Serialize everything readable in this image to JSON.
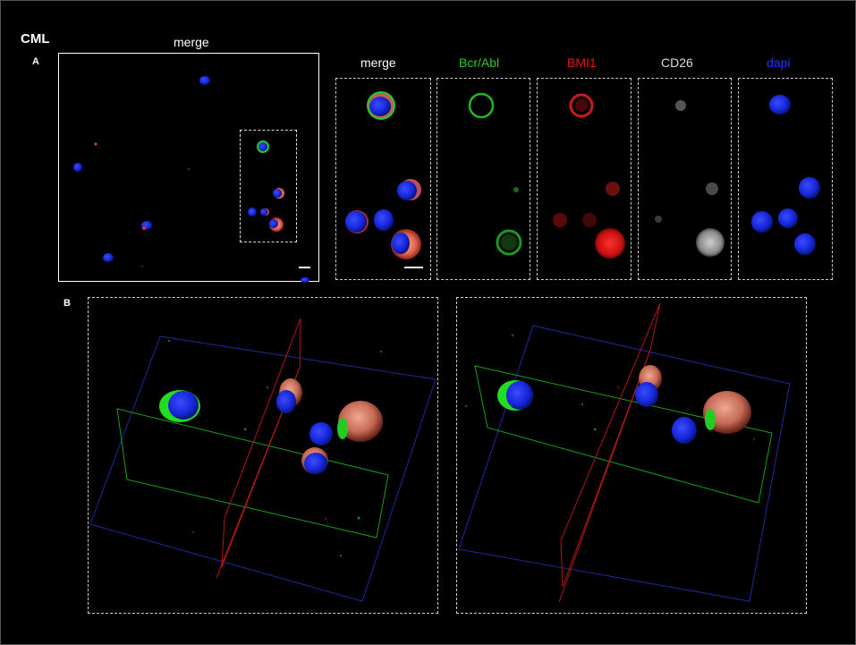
{
  "figure": {
    "title": "CML",
    "panel_a": {
      "letter": "A",
      "overview_label": "merge",
      "channel_labels": [
        {
          "text": "merge",
          "color": "#ffffff"
        },
        {
          "text": "Bcr/Abl",
          "color": "#22cc22"
        },
        {
          "text": "BMI1",
          "color": "#ee1111"
        },
        {
          "text": "CD26",
          "color": "#dddddd"
        },
        {
          "text": "dapi",
          "color": "#2233ff"
        }
      ]
    },
    "panel_b": {
      "letter": "B"
    }
  },
  "colors": {
    "background": "#000000",
    "nucleus": "#1a2cff",
    "bcr_abl": "#22dd22",
    "bmi1": "#ee2222",
    "cd26": "#cccccc"
  }
}
